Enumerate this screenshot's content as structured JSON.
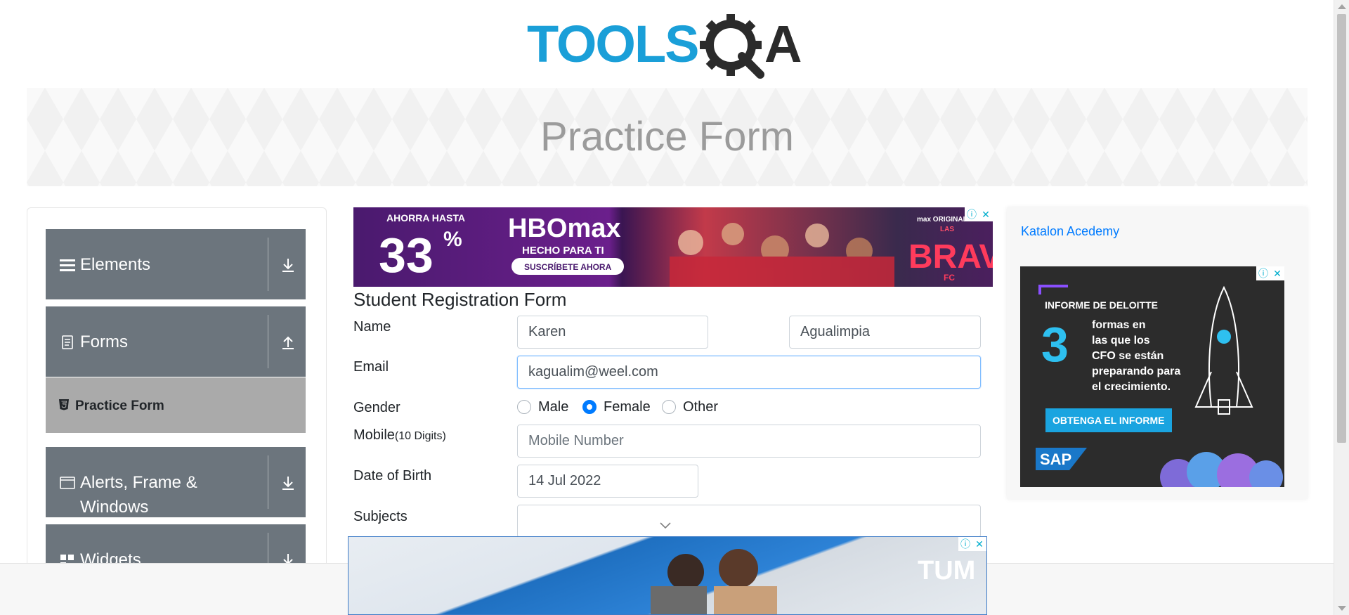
{
  "header": {
    "logo_text_left": "TOOLS",
    "logo_text_right": "A"
  },
  "banner": {
    "title": "Practice Form"
  },
  "sidebar": {
    "groups": [
      {
        "label": "Elements",
        "expanded": false
      },
      {
        "label": "Forms",
        "expanded": true
      },
      {
        "label": "Alerts, Frame &",
        "label2": "Windows",
        "expanded": false
      },
      {
        "label": "Widgets",
        "expanded": false
      }
    ],
    "active_item": "Practice Form"
  },
  "ads": {
    "top": {
      "line1": "AHORRA HASTA",
      "percent": "33",
      "percent_sign": "%",
      "brand": "HBOmax",
      "tagline": "HECHO PARA TI",
      "cta": "SUSCRÍBETE AHORA",
      "series_small": "max ORIGINAL",
      "series_las": "LAS",
      "series": "BRAVAS",
      "series_fc": "FC"
    },
    "side": {
      "link_text": "Katalon Acedemy",
      "headline": "INFORME DE DELOITTE",
      "number": "3",
      "body_lines": [
        "formas en",
        "las que los",
        "CFO se están",
        "preparando para",
        "el crecimiento."
      ],
      "cta": "OBTENGA EL INFORME",
      "brand": "SAP"
    },
    "bottom": {
      "brand": "TUM"
    }
  },
  "form": {
    "title": "Student Registration Form",
    "name_label": "Name",
    "first_name": "Karen",
    "last_name": "Agualimpia",
    "email_label": "Email",
    "email": "kagualim@weel.com",
    "gender_label": "Gender",
    "gender_options": [
      "Male",
      "Female",
      "Other"
    ],
    "gender_selected": "Female",
    "mobile_label": "Mobile",
    "mobile_hint": "(10 Digits)",
    "mobile_placeholder": "Mobile Number",
    "dob_label": "Date of Birth",
    "dob": "14 Jul 2022",
    "subjects_label": "Subjects"
  },
  "colors": {
    "logo_blue": "#1a9fd8",
    "logo_dark": "#2b2b2b",
    "sidebar_group": "#6c757d",
    "sidebar_active": "#aaaaaa",
    "radio_checked": "#007bff",
    "link": "#007bff",
    "ad_close": "#00aecd"
  }
}
